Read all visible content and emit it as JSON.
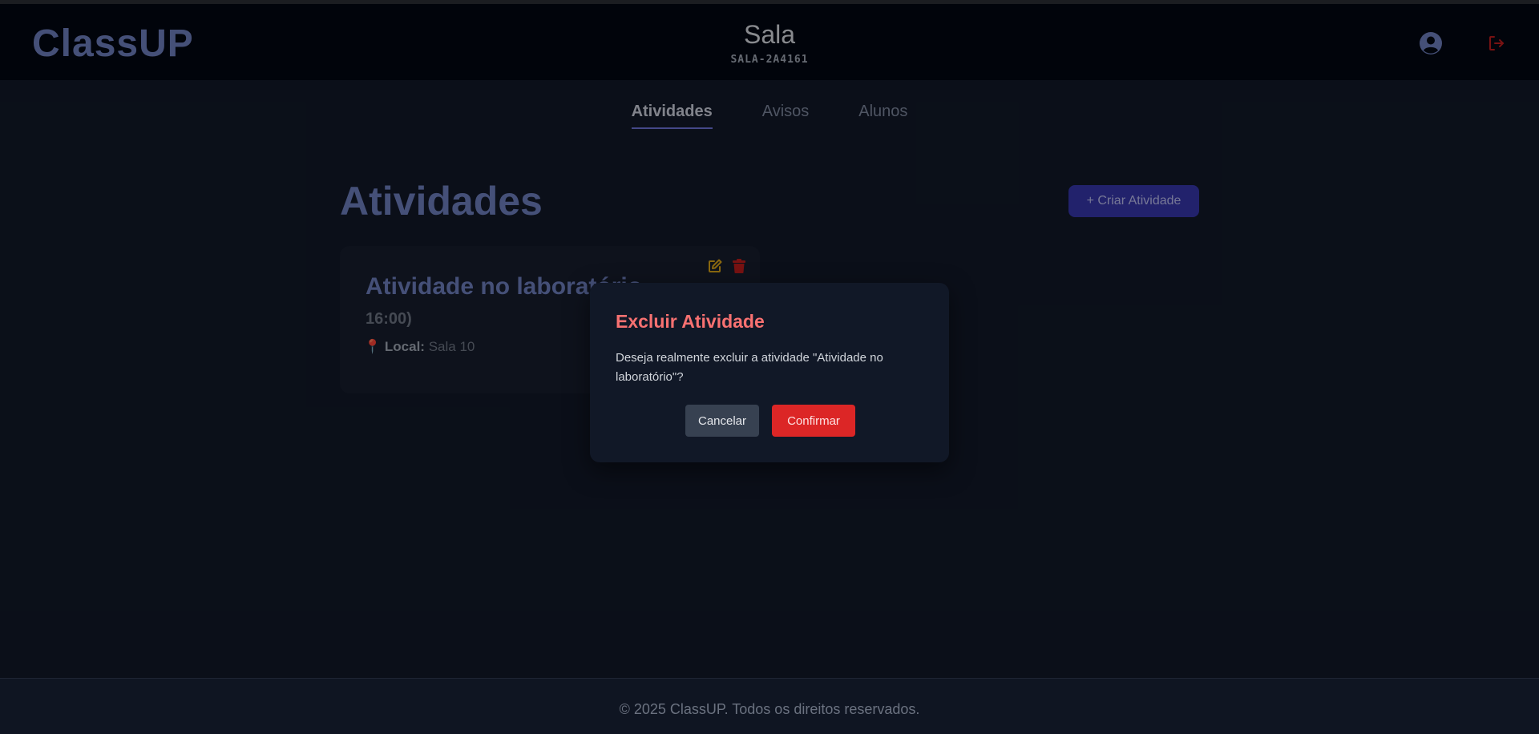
{
  "header": {
    "logo": "ClassUP",
    "room_title": "Sala",
    "room_code": "SALA-2A4161",
    "icons": {
      "user": "user-circle-icon",
      "logout": "logout-icon"
    }
  },
  "tabs": [
    {
      "label": "Atividades",
      "active": true
    },
    {
      "label": "Avisos",
      "active": false
    },
    {
      "label": "Alunos",
      "active": false
    }
  ],
  "main": {
    "title": "Atividades",
    "create_button": "+ Criar Atividade"
  },
  "card": {
    "title": "Atividade no laboratório",
    "time": "16:00)",
    "local_label": "Local:",
    "local_value": "Sala 10",
    "icons": {
      "pin": "map-pin-icon",
      "edit": "edit-icon",
      "delete": "trash-icon"
    }
  },
  "modal": {
    "title": "Excluir Atividade",
    "message": "Deseja realmente excluir a atividade \"Atividade no laboratório\"?",
    "cancel": "Cancelar",
    "confirm": "Confirmar"
  },
  "footer": {
    "text": "© 2025 ClassUP. Todos os direitos reservados."
  },
  "colors": {
    "accent": "#3535a6",
    "danger": "#dc2626",
    "warning_icon": "#d4a017"
  }
}
